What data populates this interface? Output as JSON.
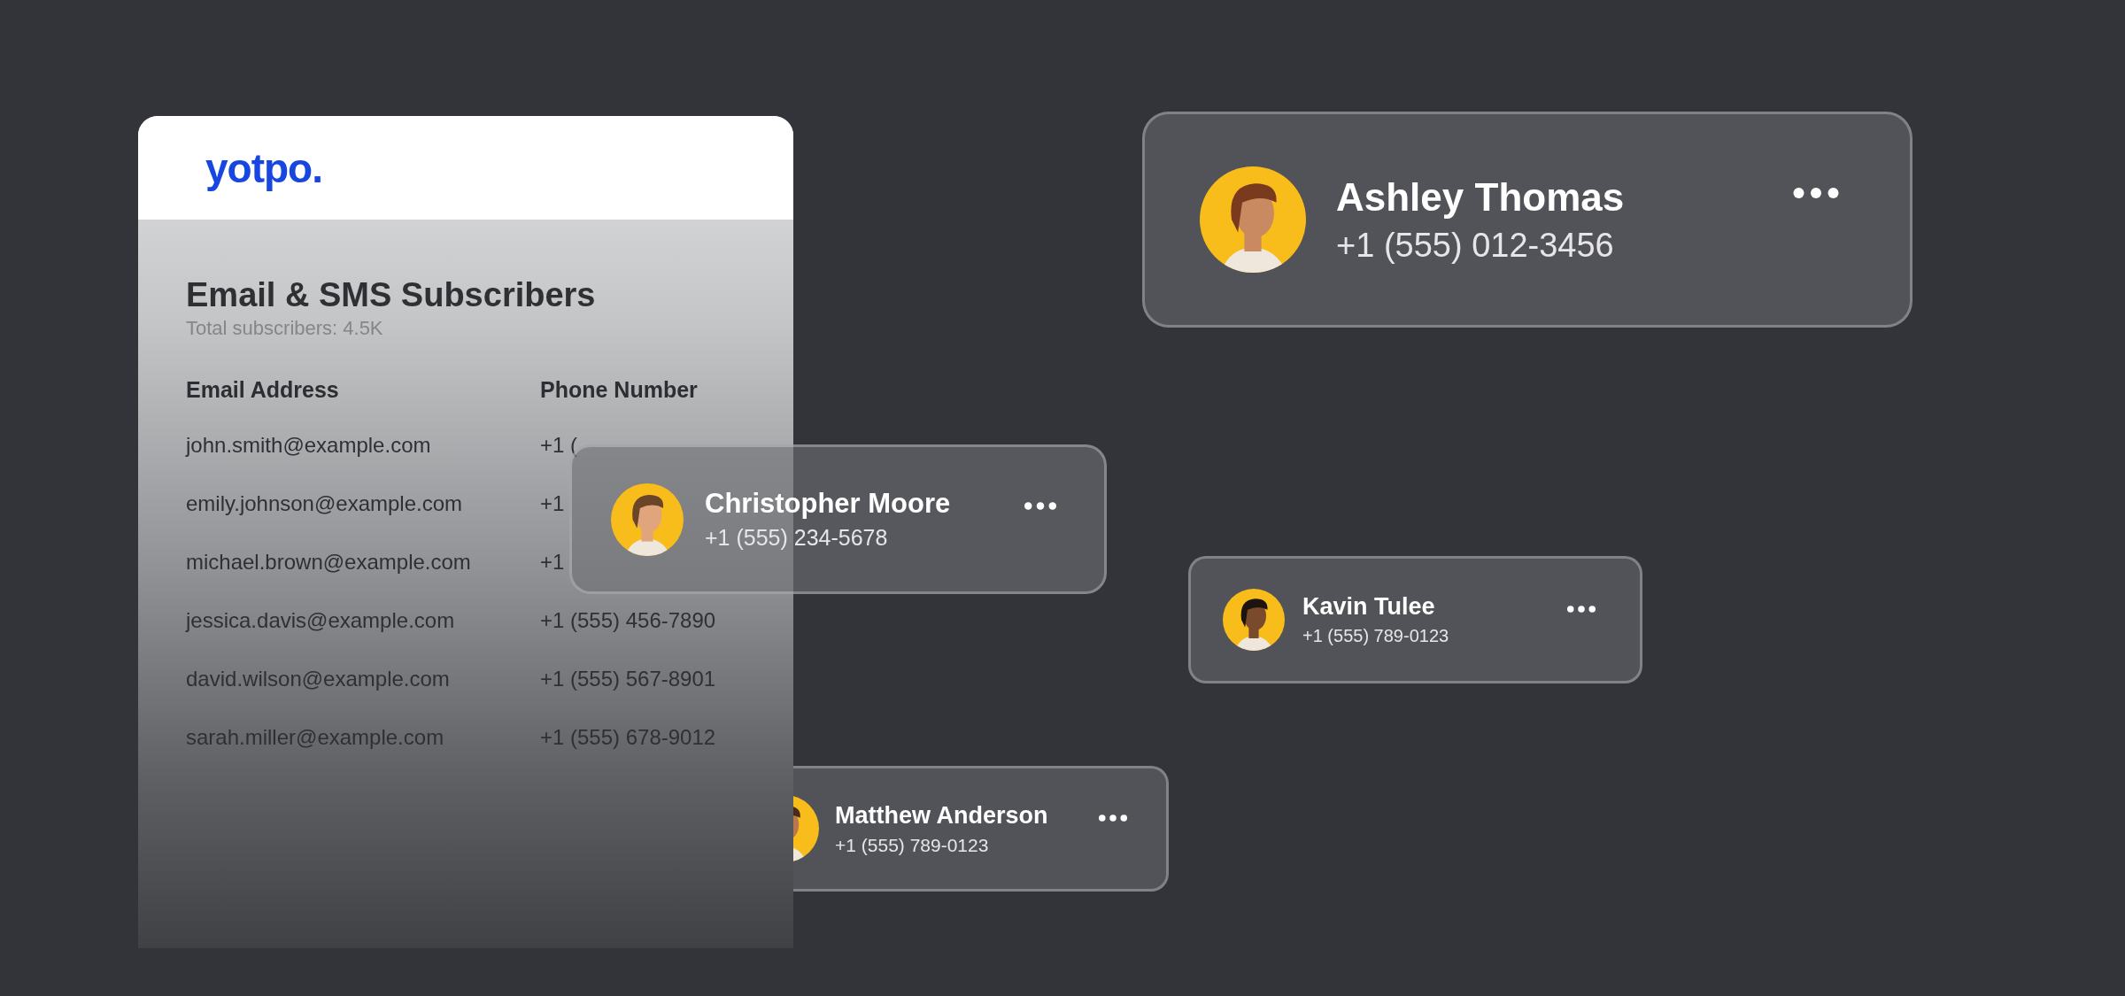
{
  "panel": {
    "logo": "yotpo.",
    "title": "Email & SMS Subscribers",
    "subtitle": "Total subscribers: 4.5K",
    "columns": [
      "Email Address",
      "Phone Number"
    ],
    "rows": [
      {
        "email": "john.smith@example.com",
        "phone": "+1 ("
      },
      {
        "email": "emily.johnson@example.com",
        "phone": "+1"
      },
      {
        "email": "michael.brown@example.com",
        "phone": "+1"
      },
      {
        "email": "jessica.davis@example.com",
        "phone": "+1 (555) 456-7890"
      },
      {
        "email": "david.wilson@example.com",
        "phone": "+1 (555) 567-8901"
      },
      {
        "email": "sarah.miller@example.com",
        "phone": "+1 (555) 678-9012"
      }
    ]
  },
  "contacts": [
    {
      "name": "Ashley Thomas",
      "phone": "+1 (555) 012-3456"
    },
    {
      "name": "Christopher Moore",
      "phone": "+1 (555) 234-5678"
    },
    {
      "name": "Kavin Tulee",
      "phone": "+1 (555) 789-0123"
    },
    {
      "name": "Matthew Anderson",
      "phone": "+1 (555) 789-0123"
    }
  ]
}
